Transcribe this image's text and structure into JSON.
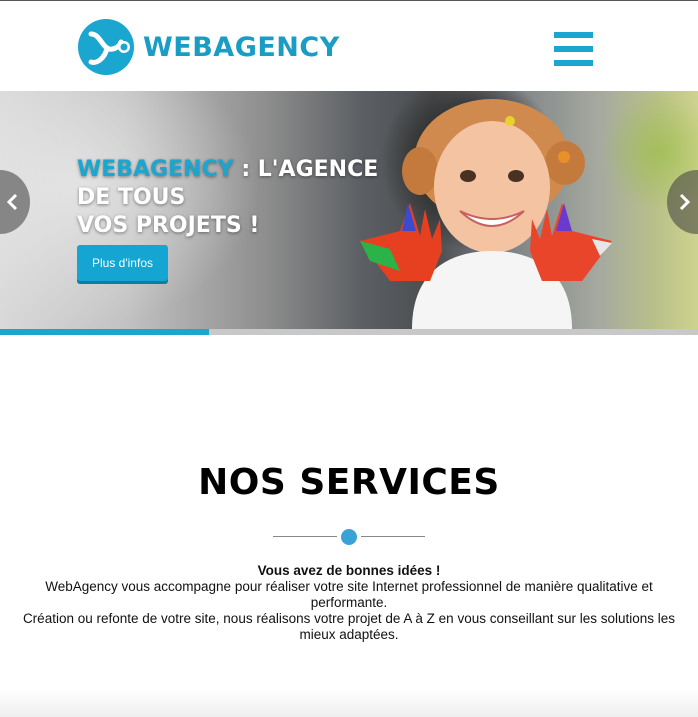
{
  "header": {
    "logo_text": "WEBAGENCY"
  },
  "hero": {
    "title_brand": "WEBAGENCY",
    "title_rest_1": " : L'AGENCE",
    "title_line_2": "DE TOUS",
    "title_line_3": "VOS PROJETS !",
    "cta_label": "Plus d'infos",
    "slider_progress": 0.3
  },
  "services": {
    "title": "NOS SERVICES",
    "lead": "Vous avez de bonnes idées !",
    "paragraph_1": "WebAgency vous accompagne pour réaliser votre site Internet professionnel de manière qualitative et performante.",
    "paragraph_2": "Création ou refonte de votre site, nous réalisons votre projet de A à Z en vous conseillant sur les solutions les mieux adaptées."
  },
  "colors": {
    "accent": "#1aa6cf",
    "brand_text": "#1a9dc4",
    "cta": "#14a5d3"
  },
  "icons": {
    "logo": "webagency-logo-icon",
    "menu": "hamburger-menu-icon",
    "prev": "chevron-left-icon",
    "next": "chevron-right-icon"
  }
}
